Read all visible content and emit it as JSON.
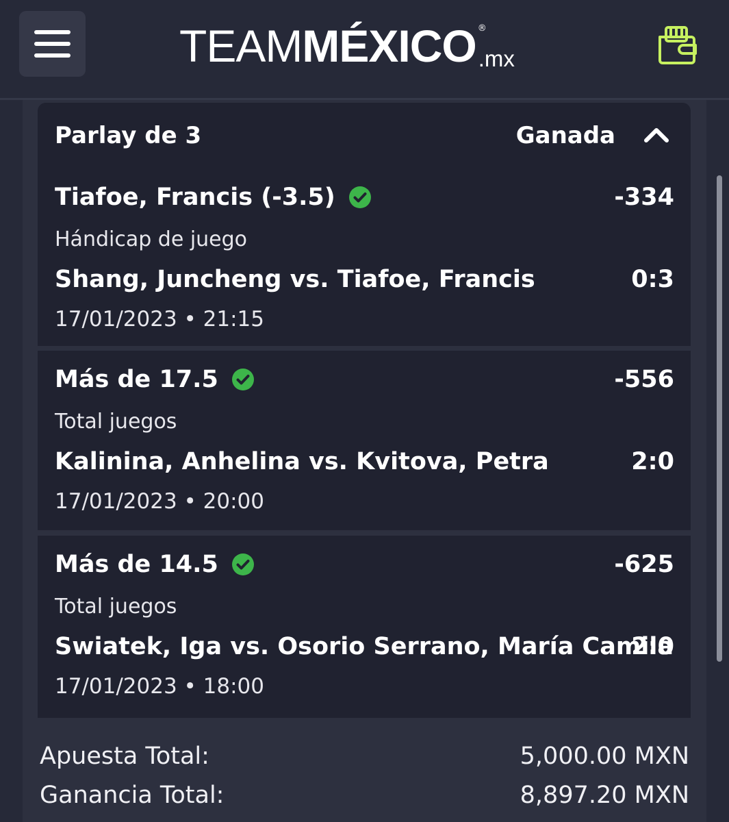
{
  "header": {
    "logo_team": "TEAM",
    "logo_mexico": "MÉXICO",
    "logo_reg": "®",
    "logo_mx": ".mx",
    "menu_icon": "hamburger-menu-icon",
    "wallet_icon": "wallet-icon"
  },
  "colors": {
    "background": "#262938",
    "card": "#202230",
    "accent_wallet": "#c6f060",
    "check_green": "#3db54a"
  },
  "parlay": {
    "title": "Parlay de 3",
    "status": "Ganada",
    "selections": [
      {
        "pick": "Tiafoe, Francis (-3.5)",
        "odds": "-334",
        "market": "Hándicap de juego",
        "match": "Shang, Juncheng vs. Tiafoe, Francis",
        "score": "0:3",
        "datetime": "17/01/2023 • 21:15"
      },
      {
        "pick": "Más de 17.5",
        "odds": "-556",
        "market": "Total juegos",
        "match": "Kalinina, Anhelina vs. Kvitova, Petra",
        "score": "2:0",
        "datetime": "17/01/2023 • 20:00"
      },
      {
        "pick": "Más de 14.5",
        "odds": "-625",
        "market": "Total juegos",
        "match": "Swiatek, Iga vs. Osorio Serrano, María Camila",
        "score": "2:0",
        "datetime": "17/01/2023 • 18:00"
      }
    ]
  },
  "totals": {
    "stake_label": "Apuesta Total:",
    "stake_value": "5,000.00 MXN",
    "payout_label": "Ganancia Total:",
    "payout_value": "8,897.20 MXN"
  }
}
